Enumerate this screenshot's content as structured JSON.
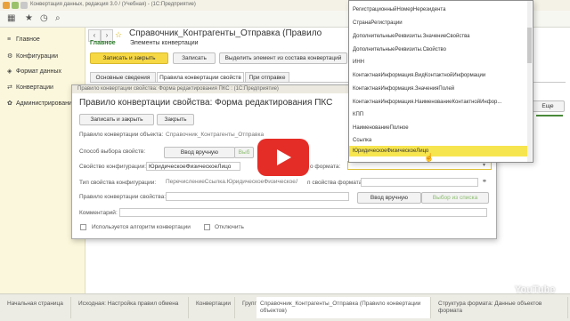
{
  "window": {
    "title": "Конвертация данных, редакция 3.0 / (Учебная) - (1С:Предприятие)"
  },
  "sidebar": {
    "items": [
      {
        "label": "Главное",
        "icon": "menu-icon"
      },
      {
        "label": "Конфигурации",
        "icon": "gear-icon"
      },
      {
        "label": "Формат данных",
        "icon": "format-icon"
      },
      {
        "label": "Конвертации",
        "icon": "convert-icon"
      },
      {
        "label": "Администрирование",
        "icon": "admin-icon"
      }
    ]
  },
  "main": {
    "title": "Справочник_Контрагенты_Отправка (Правило",
    "nav_tabs": [
      "Главное",
      "Элементы конвертации"
    ],
    "buttons": {
      "save_close": "Записать и закрыть",
      "save": "Записать",
      "highlight": "Выделить элемент из состава конвертаций"
    },
    "form_tabs": [
      "Основные сведения",
      "Правила конвертации свойств",
      "При отправке"
    ],
    "right_field": "Еще"
  },
  "dialog": {
    "header": "Правило конвертации свойства: Форма редактирования ПКС : (1С:Предприятие)",
    "title": "Правило конвертации свойства: Форма редактирования ПКС",
    "buttons": {
      "save_close": "Записать и закрыть",
      "close": "Закрыть",
      "manual1": "Ввод вручную",
      "select1": "Выб",
      "manual2": "Ввод вручную",
      "select2": "Выбор из списка"
    },
    "labels": {
      "object_rule": "Правило конвертации объекта:",
      "select_method": "Способ выбора свойств:",
      "config_property": "Свойство конфигурации:",
      "format_property": "о формата:",
      "config_property_type": "Тип свойства конфигурации:",
      "format_property_type": "п свойства формата:",
      "property_rule": "Правило конвертации свойства:",
      "comment": "Комментарий:",
      "use_algorithm": "Используется алгоритм конвертации",
      "disable": "Отключить"
    },
    "values": {
      "object_rule": "Справочник_Контрагенты_Отправка",
      "config_property": "ЮридическоеФизическоеЛицо",
      "config_property_type": "ПеречислениеСсылка.ЮридическоеФизическоеЛицо"
    }
  },
  "dropdown": {
    "items": [
      "РегистрационныйНомерНерезидента",
      "СтранаРегистрации",
      "ДополнительныеРеквизиты.ЗначениеСвойства",
      "ДополнительныеРеквизиты.Свойство",
      "ИНН",
      "КонтактнаяИнформация.ВидКонтактнойИнформации",
      "КонтактнаяИнформация.ЗначенияПолей",
      "КонтактнаяИнформация.НаименованиеКонтактнойИнфор...",
      "КПП",
      "НаименованиеПолное",
      "Ссылка",
      "ЮридическоеФизическоеЛицо"
    ],
    "selected_index": 11,
    "highlight_color": "#f7e54f"
  },
  "taskbar": {
    "tasks": [
      "Начальная страница",
      "Исходная: Настройка правил обмена",
      "Конвертации",
      "Группы правил",
      "Справочник_Контрагенты_Отправка (Правило конвертации объектов)",
      "Структура формата: Данные объектов формата"
    ],
    "active_index": 4
  },
  "overlay": {
    "brand": "YouTube"
  }
}
